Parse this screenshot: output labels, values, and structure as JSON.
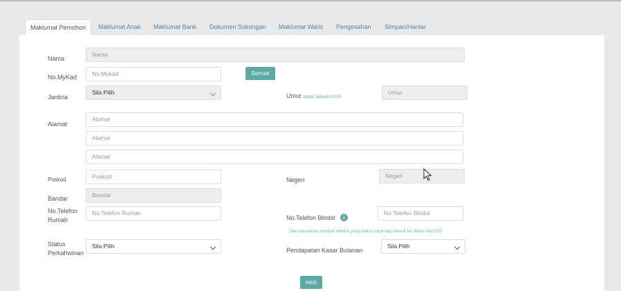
{
  "tabs": [
    {
      "label": "Maklumat Pemohon"
    },
    {
      "label": "Maklumat Anak"
    },
    {
      "label": "Maklumat Bank"
    },
    {
      "label": "Dokumen Sokongan"
    },
    {
      "label": "Maklumat Waris"
    },
    {
      "label": "Pengesahan"
    },
    {
      "label": "Simpan/Hantar"
    }
  ],
  "form": {
    "nama_label": "Nama",
    "nama_placeholder": "Nama",
    "mykad_label": "No.MyKad",
    "mykad_placeholder": "No.Mykad",
    "semak_button": "Semak",
    "jantina_label": "Jantina",
    "jantina_value": "Sila Pilih",
    "umur_label": "Umur",
    "umur_note": "pada Januari 2019",
    "umur_placeholder": "Umur",
    "alamat_label": "Alamat",
    "alamat1_placeholder": "Alamat",
    "alamat2_placeholder": "Alamat",
    "alamat3_placeholder": "Alamat",
    "poskod_label": "Poskod",
    "poskod_placeholder": "Poskod",
    "negeri_label": "Negeri",
    "negeri_placeholder": "Negeri",
    "bandar_label": "Bandar",
    "bandar_placeholder": "Bandar",
    "tel_rumah_label_1": "No.Telefon",
    "tel_rumah_label_2": "Rumah",
    "tel_rumah_placeholder": "No.Telefon Rumah",
    "tel_bimbit_label": "No.Telefon Bimbit",
    "info_glyph": "i",
    "tel_bimbit_placeholder": "No.Telefon Bimbit",
    "tel_bimbit_hint": "Sila masukkan nombor telefon yang betul untuk tag masuk ke dalam MySSH",
    "status_label_1": "Status",
    "status_label_2": "Perkahwinan",
    "status_value": "Sila Pilih",
    "pendapatan_label": "Pendapatan Kasar Bulanan",
    "pendapatan_value": "Sila Pilih",
    "next_button": "next"
  },
  "colors": {
    "accent": "#5aaba4",
    "link": "#4f86b3",
    "readonly_bg": "#eeeeee"
  }
}
